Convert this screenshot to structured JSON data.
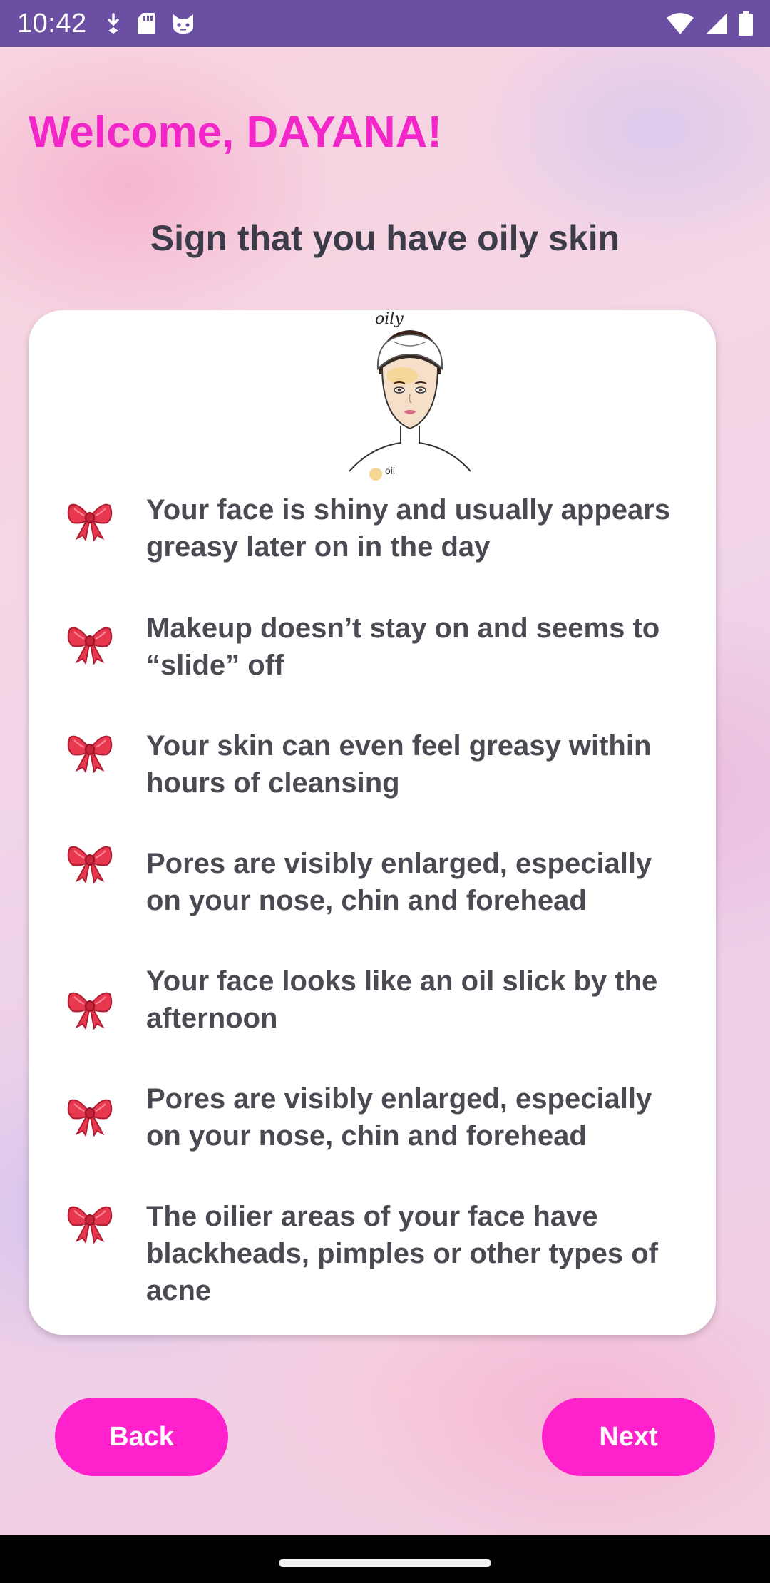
{
  "status_bar": {
    "time": "10:42",
    "left_icons": [
      "download-icon",
      "sd-card-icon",
      "cat-face-icon"
    ],
    "right_icons": [
      "wifi-icon",
      "cell-signal-icon",
      "battery-icon"
    ]
  },
  "header": {
    "welcome": "Welcome, DAYANA!",
    "subtitle": "Sign that you have oily skin"
  },
  "illustration": {
    "title": "oily",
    "legend": "oil",
    "icon": "face-with-headband-icon"
  },
  "signs": [
    {
      "icon": "bow-icon",
      "text": "Your face is shiny and usually appears greasy later on in the day"
    },
    {
      "icon": "bow-icon",
      "text": "Makeup doesn’t stay on and seems to “slide” off"
    },
    {
      "icon": "bow-icon",
      "text": "Your skin can even feel greasy within hours of cleansing"
    },
    {
      "icon": "bow-icon",
      "text": "Pores are visibly enlarged, especially on your nose, chin and forehead"
    },
    {
      "icon": "bow-icon",
      "text": "Your face looks like an oil slick by the afternoon"
    },
    {
      "icon": "bow-icon",
      "text": "Pores are visibly enlarged, especially on your nose, chin and forehead"
    },
    {
      "icon": "bow-icon",
      "text": "The oilier areas of your face have blackheads, pimples or other types of acne"
    }
  ],
  "buttons": {
    "back": "Back",
    "next": "Next"
  },
  "colors": {
    "status_bar": "#6a4fa3",
    "welcome_text": "#f226c9",
    "button": "#ff21cc",
    "body_text": "#4a4a52"
  }
}
